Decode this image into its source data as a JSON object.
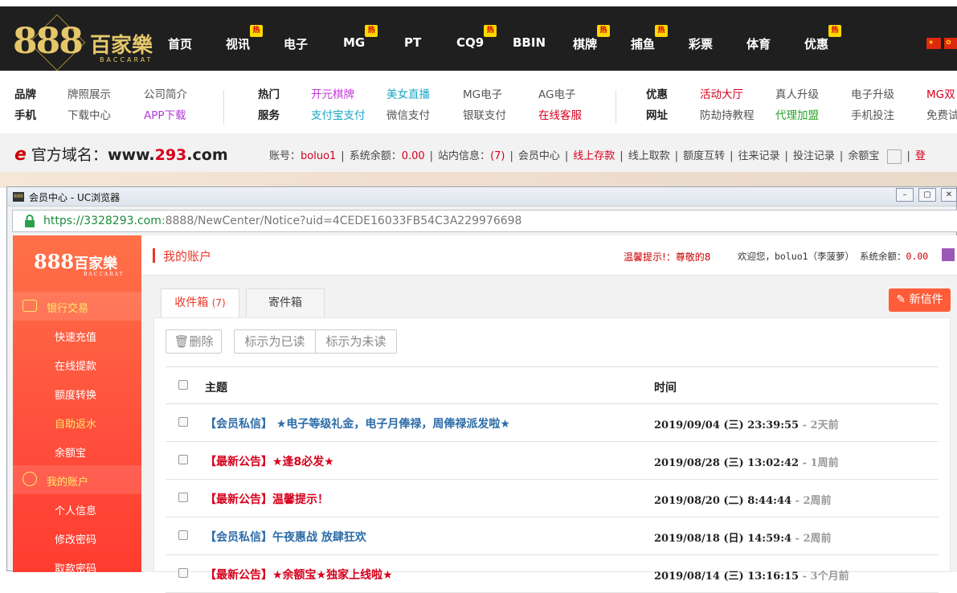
{
  "nav": {
    "logo_num": "888",
    "logo_cn": "百家樂",
    "logo_en": "BACCARAT",
    "hot_label": "热",
    "items": [
      {
        "label": "首页"
      },
      {
        "label": "视讯"
      },
      {
        "label": "电子"
      },
      {
        "label": "MG"
      },
      {
        "label": "PT"
      },
      {
        "label": "CQ9"
      },
      {
        "label": "BBIN"
      },
      {
        "label": "棋牌"
      },
      {
        "label": "捕鱼"
      },
      {
        "label": "彩票"
      },
      {
        "label": "体育"
      },
      {
        "label": "优惠"
      }
    ]
  },
  "subnav": {
    "g1": {
      "h1": "品牌",
      "h2": "手机",
      "a1": "牌照展示",
      "a2": "公司简介",
      "b1": "下载中心",
      "b2": "APP下载"
    },
    "g2": {
      "h1": "热门",
      "h2": "服务",
      "a1": "开元棋牌",
      "a2": "美女直播",
      "a3": "MG电子",
      "a4": "AG电子",
      "b1": "支付宝支付",
      "b2": "微信支付",
      "b3": "银联支付",
      "b4": "在线客服"
    },
    "g3": {
      "h1": "优惠",
      "h2": "网址",
      "a1": "活动大厅",
      "a2": "真人升级",
      "a3": "电子升级",
      "a4": "MG双",
      "b1": "防劫持教程",
      "b2": "代理加盟",
      "b3": "手机投注",
      "b4": "免费试"
    }
  },
  "infobar": {
    "domain_label": "官方域名：",
    "domain_prefix": "www.",
    "domain_num": "293",
    "domain_suffix": ".com",
    "account_label": "账号：",
    "account": "boluo1",
    "balance_label": "系统余额：",
    "balance": "0.00",
    "msg_label": "站内信息：",
    "msg_count": "(7)",
    "links": [
      "会员中心",
      "线上存款",
      "线上取款",
      "额度互转",
      "往来记录",
      "投注记录",
      "余额宝"
    ],
    "trail": "登"
  },
  "window": {
    "title": "会员中心 - UC浏览器",
    "url_host": "https://3328293.com",
    "url_rest": ":8888/NewCenter/Notice?uid=4CEDE16033FB54C3A229976698"
  },
  "sidebar": {
    "logo_num": "888",
    "logo_cn": "百家樂",
    "logo_en": "BACCARAT",
    "group1": "银行交易",
    "group1_items": [
      "快速充值",
      "在线提款",
      "额度转换",
      "自助返水",
      "余额宝"
    ],
    "group2": "我的账户",
    "group2_items": [
      "个人信息",
      "修改密码",
      "取款密码"
    ]
  },
  "main": {
    "title": "我的账户",
    "tip": "温馨提示!：尊敬的8",
    "welcome": "欢迎您，boluo1（李菠萝）",
    "balance_label": "系统余额：",
    "balance": "0.00",
    "tab_inbox": "收件箱",
    "tab_inbox_count": "(7)",
    "tab_outbox": "寄件箱",
    "new_mail": "新信件",
    "btn_delete": "删除",
    "btn_mark_read": "标示为已读",
    "btn_mark_unread": "标示为未读",
    "col_subject": "主题",
    "col_time": "时间",
    "messages": [
      {
        "subject": "【会员私信】 ★电子等级礼金，电子月俸禄，周俸禄派发啦★",
        "date": "2019/09/04 (三) 23:39:55",
        "ago": "- 2天前"
      },
      {
        "subject": "【最新公告】★逢8必发★",
        "date": "2019/08/28 (三) 13:02:42",
        "ago": "- 1周前"
      },
      {
        "subject": "【最新公告】温馨提示！",
        "date": "2019/08/20 (二) 8:44:44",
        "ago": "- 2周前"
      },
      {
        "subject": "【会员私信】午夜惠战 放肆狂欢",
        "date": "2019/08/18 (日) 14:59:4",
        "ago": "- 2周前"
      },
      {
        "subject": "【最新公告】★余额宝★独家上线啦★",
        "date": "2019/08/14 (三) 13:16:15",
        "ago": "- 3个月前"
      }
    ]
  }
}
